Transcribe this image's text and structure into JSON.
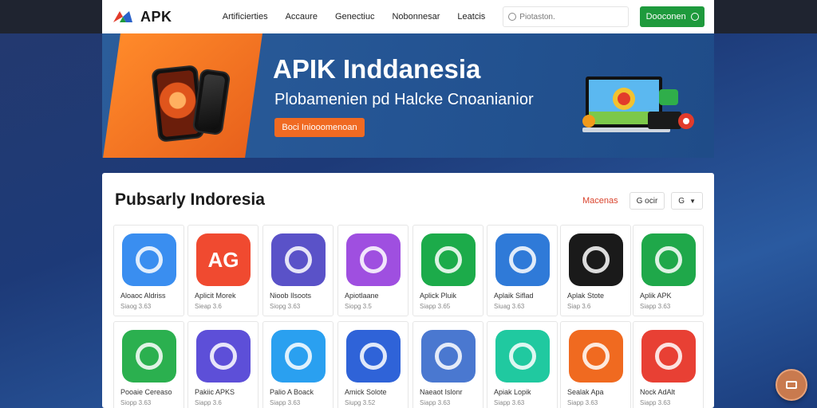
{
  "header": {
    "logo_text": "APK",
    "nav": [
      "Artificierties",
      "Accaure",
      "Genectiuc",
      "Nobonnesar",
      "Leatcis"
    ],
    "search_placeholder": "Piotaston.",
    "download_label": "Dooconen"
  },
  "banner": {
    "title": "APIK Inddanesia",
    "subtitle": "Plobamenien pd Halcke Cnoanianior",
    "cta_label": "Boci Iniooomenoan"
  },
  "section": {
    "title": "Pubsarly Indoresia",
    "filter_label": "Macenas",
    "filter_button_1": "G  ocir",
    "filter_button_2": "G"
  },
  "apps": [
    {
      "name": "Aloaoc Aldriss",
      "meta": "Siaog 3.63",
      "color": "#3a8ef0",
      "icon": "pencil-icon"
    },
    {
      "name": "Aplicit Morek",
      "meta": "Sieap 3.6",
      "color": "#f04a30",
      "icon": "ag-logo-icon",
      "glyph": "AG"
    },
    {
      "name": "Nioob Ilsoots",
      "meta": "Siopg 3.63",
      "color": "#5a52c8",
      "icon": "play-store-icon"
    },
    {
      "name": "Apiotlaane",
      "meta": "Siopg 3.5",
      "color": "#9f4fe0",
      "icon": "triangle-logo-icon"
    },
    {
      "name": "Aplick Pluik",
      "meta": "Siapp 3.65",
      "color": "#1cab4a",
      "icon": "ring-icon"
    },
    {
      "name": "Aplaik Siflad",
      "meta": "Siuag 3.63",
      "color": "#2f7ad8",
      "icon": "camera-lens-icon"
    },
    {
      "name": "Aplak Stote",
      "meta": "Siap 3.6",
      "color": "#1a1a1a",
      "icon": "rocket-icon"
    },
    {
      "name": "Aplik APK",
      "meta": "Siapp 3.63",
      "color": "#1fa84a",
      "icon": "media-arrows-icon"
    },
    {
      "name": "Pooaie Cereaso",
      "meta": "Siopp 3.63",
      "color": "#2bb04f",
      "icon": "cat-icon"
    },
    {
      "name": "Pakiic APKS",
      "meta": "Siapp 3.6",
      "color": "#5d4fd8",
      "icon": "grid-apps-icon"
    },
    {
      "name": "Palio A Boack",
      "meta": "Siapp 3.63",
      "color": "#2aa0f0",
      "icon": "plane-icon"
    },
    {
      "name": "Amick Solote",
      "meta": "Siupg 3.52",
      "color": "#2f63d8",
      "icon": "star-icon"
    },
    {
      "name": "Naeaot Islonr",
      "meta": "Siapp 3.63",
      "color": "#4a78d0",
      "icon": "drive-triangle-icon"
    },
    {
      "name": "Apiak Lopik",
      "meta": "Siapp 3.63",
      "color": "#20c9a0",
      "icon": "rocket-pen-icon"
    },
    {
      "name": "Sealak Apa",
      "meta": "Siapp 3.63",
      "color": "#f06a20",
      "icon": "paper-plane-icon"
    },
    {
      "name": "Nock AdAlt",
      "meta": "Siapp 3.63",
      "color": "#e84034",
      "icon": "chat-dots-icon"
    }
  ],
  "fab": {
    "icon": "chat-icon"
  }
}
